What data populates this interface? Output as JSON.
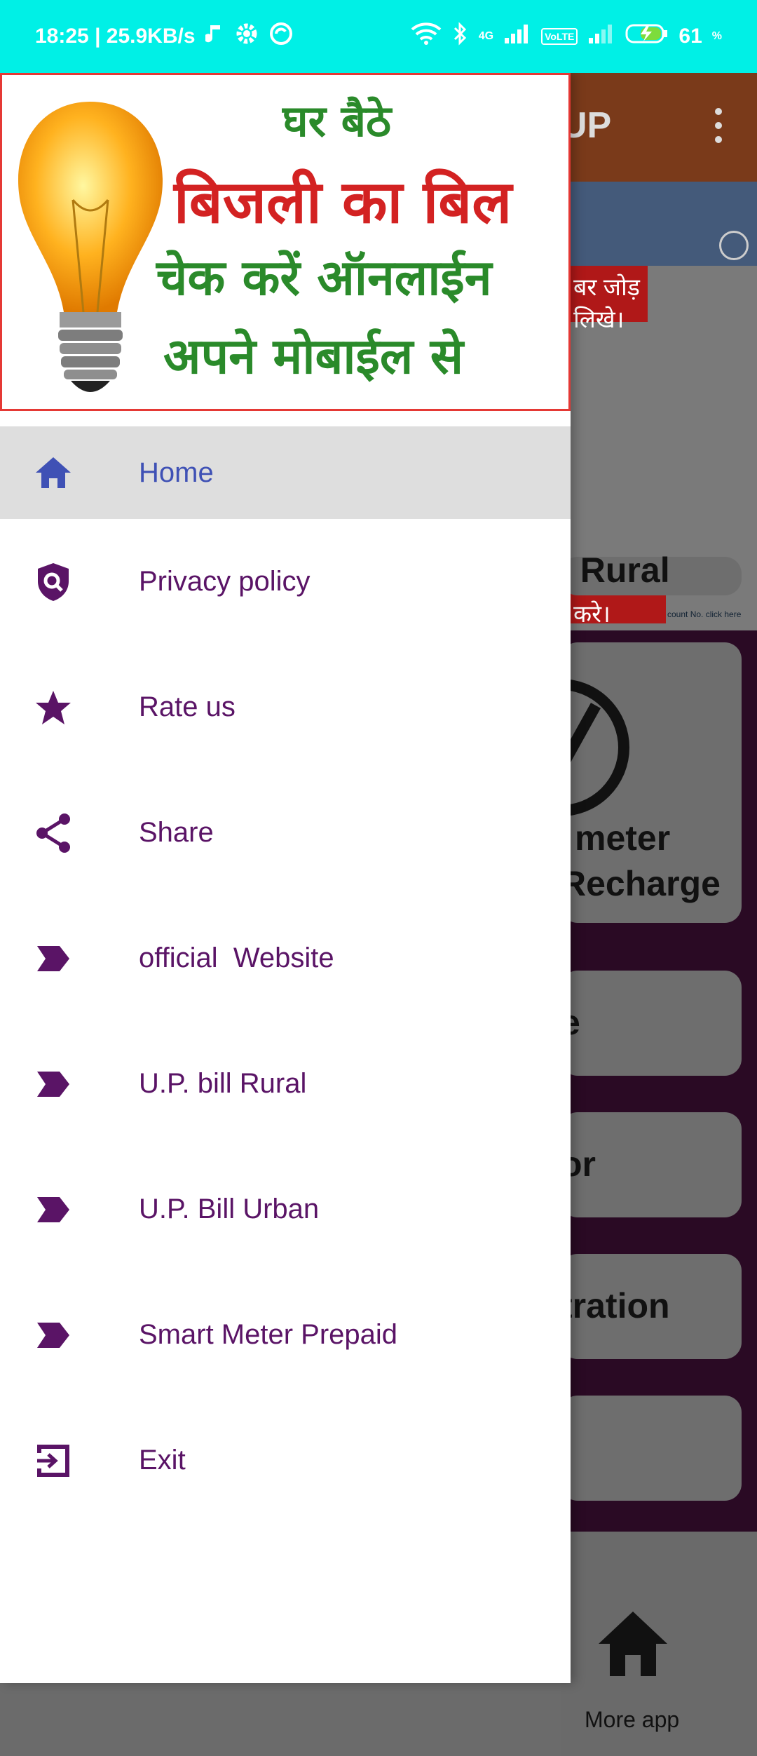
{
  "status_bar": {
    "time_speed": "18:25 | 25.9KB/s",
    "network_label": "4G",
    "volte_label": "VoLTE",
    "battery": "61"
  },
  "background_app": {
    "title_fragment": "UP",
    "banner_red1": "बर जोड़ लिखे।",
    "banner_red2": "हाँ क्लिक करे।",
    "banner_small": "count No. click here",
    "card1_text": ". Rural",
    "card2_text1": "meter",
    "card2_text2": "Recharge",
    "card3_text": "e",
    "card4_text": "or",
    "card5_text": "tration",
    "bottom_label": "More app"
  },
  "drawer": {
    "header": {
      "line1": "घर बैठे",
      "line2": "बिजली का बिल",
      "line3": "चेक करें ऑनलाईन",
      "line4": "अपने मोबाईल से"
    },
    "items": [
      {
        "label": "Home",
        "icon": "home-icon"
      },
      {
        "label": "Privacy policy",
        "icon": "shield-search-icon"
      },
      {
        "label": "Rate us",
        "icon": "star-icon"
      },
      {
        "label": "Share",
        "icon": "share-icon"
      },
      {
        "label": "official  Website",
        "icon": "label-arrow-icon"
      },
      {
        "label": "U.P. bill Rural",
        "icon": "label-arrow-icon"
      },
      {
        "label": "U.P. Bill Urban",
        "icon": "label-arrow-icon"
      },
      {
        "label": "Smart Meter Prepaid",
        "icon": "label-arrow-icon"
      },
      {
        "label": "Exit",
        "icon": "exit-icon"
      }
    ]
  },
  "colors": {
    "status_bar": "#00f0e6",
    "menu_text": "#5a1466",
    "active_text": "#3f51b5",
    "active_bg": "#dedede",
    "header_border": "#e53935"
  }
}
